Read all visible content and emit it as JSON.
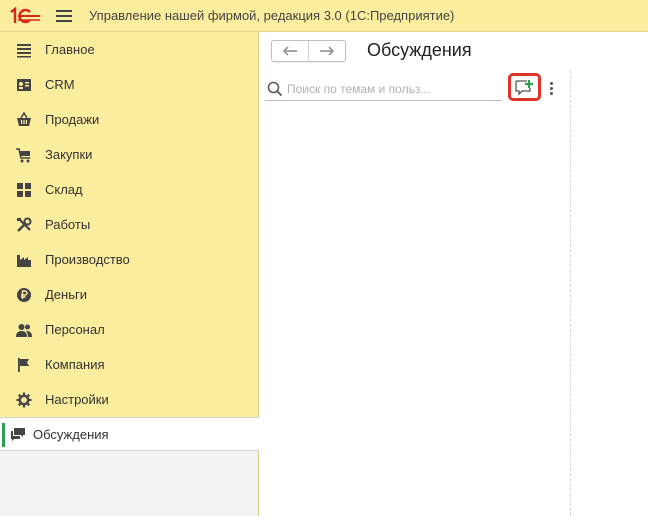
{
  "app": {
    "title": "Управление нашей фирмой, редакция 3.0  (1С:Предприятие)"
  },
  "sidebar": {
    "items": [
      {
        "label": "Главное",
        "icon": "list-icon"
      },
      {
        "label": "CRM",
        "icon": "crm-card-icon"
      },
      {
        "label": "Продажи",
        "icon": "basket-icon"
      },
      {
        "label": "Закупки",
        "icon": "cart-icon"
      },
      {
        "label": "Склад",
        "icon": "warehouse-grid-icon"
      },
      {
        "label": "Работы",
        "icon": "tools-icon"
      },
      {
        "label": "Производство",
        "icon": "factory-icon"
      },
      {
        "label": "Деньги",
        "icon": "ruble-coin-icon"
      },
      {
        "label": "Персонал",
        "icon": "people-icon"
      },
      {
        "label": "Компания",
        "icon": "flag-icon"
      },
      {
        "label": "Настройки",
        "icon": "gear-icon"
      }
    ],
    "active": {
      "label": "Обсуждения",
      "icon": "chat-bubbles-icon"
    }
  },
  "main": {
    "title": "Обсуждения",
    "search": {
      "placeholder": "Поиск по темам и польз..."
    }
  },
  "colors": {
    "panel_yellow": "#fbed9e",
    "highlight_red": "#e0312a",
    "accent_green": "#2e9e55",
    "logo_red": "#d6291b"
  }
}
